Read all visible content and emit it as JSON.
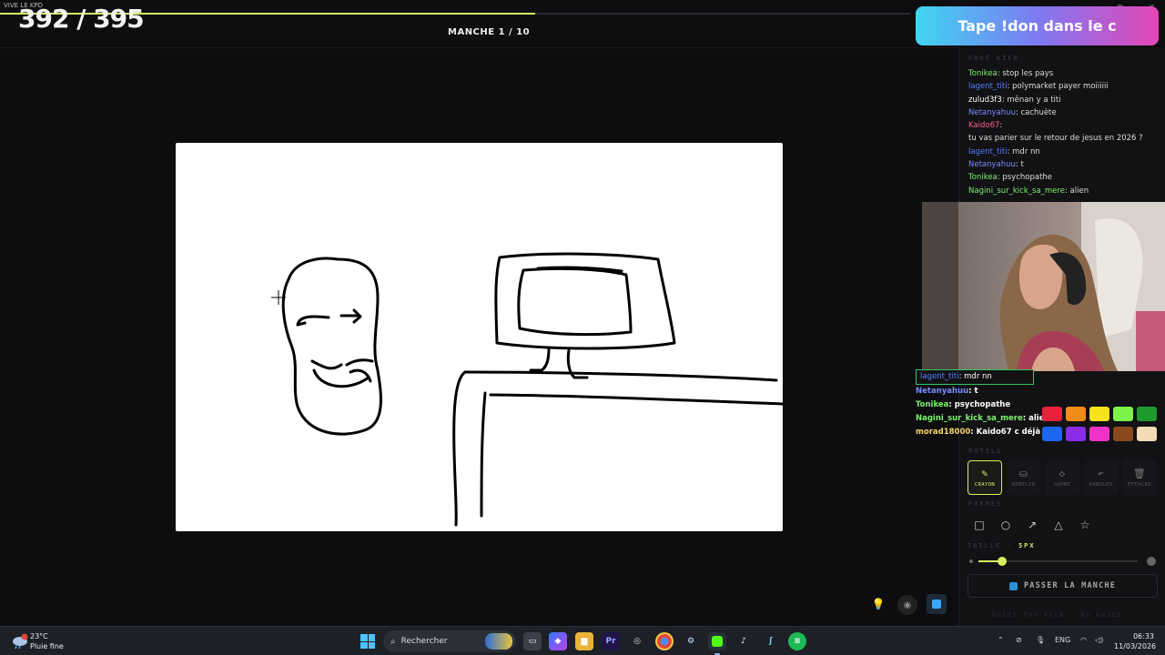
{
  "window": {
    "title": "VIVE LE KPD"
  },
  "header": {
    "score": "392 / 395",
    "progress_fraction": 0.5875,
    "round_label": "MANCHE 1 / 10"
  },
  "banner": {
    "text": "Tape !don dans le c"
  },
  "chat": {
    "section_label": "CHAT KICK",
    "messages": [
      {
        "user": "Tonikea",
        "text": "stop les pays",
        "user_color": "#7cf26b"
      },
      {
        "user": "lagent_titi",
        "text": "polymarket payer moiiiiii",
        "user_color": "#5b7dff"
      },
      {
        "user": "zulud3f3",
        "text": "mênan y a titi",
        "user_color": "#ffffff"
      },
      {
        "user": "Netanyahuu",
        "text": "cachuète",
        "user_color": "#7a8bff"
      },
      {
        "user": "Kaido67",
        "text": "",
        "user_color": "#ff5f8a"
      },
      {
        "user": "",
        "text": "tu vas parier sur le retour de jesus en 2026 ?",
        "user_color": "#ffffff"
      },
      {
        "user": "lagent_titi",
        "text": "mdr nn",
        "user_color": "#5b7dff"
      },
      {
        "user": "Netanyahuu",
        "text": "t",
        "user_color": "#7a8bff"
      },
      {
        "user": "Tonikea",
        "text": "psychopathe",
        "user_color": "#7cf26b"
      },
      {
        "user": "Nagini_sur_kick_sa_mere",
        "text": "alien",
        "user_color": "#7cf26b"
      }
    ]
  },
  "overlay_chat": [
    {
      "user": "lagent_titi",
      "text": "mdr nn",
      "user_color": "#5b7dff"
    },
    {
      "user": "Netanyahuu",
      "text": "t",
      "user_color": "#7a8bff"
    },
    {
      "user": "Tonikea",
      "text": "psychopathe",
      "user_color": "#7cf26b"
    },
    {
      "user": "Nagini_sur_kick_sa_mere",
      "text": "alien",
      "user_color": "#7cf26b"
    },
    {
      "user": "morad18000",
      "text": "Kaido67 c déjà fait",
      "user_color": "#f5d36a"
    }
  ],
  "palette": {
    "colors": [
      "#e5243b",
      "#f28c18",
      "#f7e21b",
      "#7cf24a",
      "#1f9a2f",
      "#1c66f0",
      "#8b2ce8",
      "#ef33c8",
      "#8a4a1e",
      "#f1dcb6"
    ]
  },
  "tools": {
    "section_label": "OUTILS",
    "items": [
      {
        "label": "CRAYON",
        "icon": "pencil-icon",
        "active": true
      },
      {
        "label": "REMPLIR",
        "icon": "bucket-icon",
        "active": false
      },
      {
        "label": "GOMME",
        "icon": "eraser-icon",
        "active": false
      },
      {
        "label": "ANNULER",
        "icon": "undo-icon",
        "active": false
      },
      {
        "label": "EFFACER",
        "icon": "trash-icon",
        "active": false
      }
    ]
  },
  "shapes": {
    "section_label": "FORMES",
    "items": [
      "rectangle-icon",
      "ellipse-icon",
      "arrow-icon",
      "triangle-icon",
      "star-icon"
    ]
  },
  "brush": {
    "label": "TAILLE",
    "value": "5PX",
    "fraction": 0.15
  },
  "pass_button": {
    "label": "PASSER LA MANCHE"
  },
  "footer": {
    "credit": "built for kick · by kaido"
  },
  "taskbar": {
    "temperature": "23°C",
    "weather": "Pluie fine",
    "search_placeholder": "Rechercher",
    "language": "ENG",
    "time": "06:33",
    "date": "11/03/2026"
  }
}
